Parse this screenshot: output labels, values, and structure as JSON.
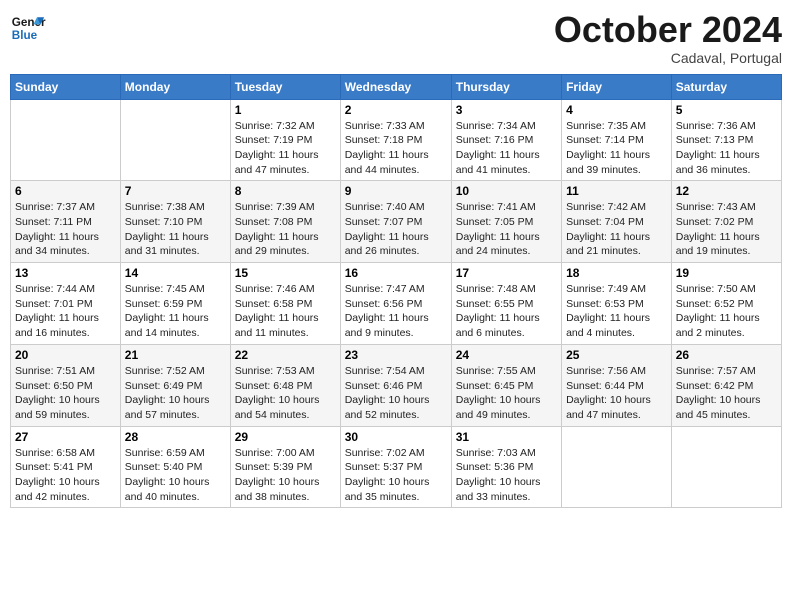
{
  "logo": {
    "line1": "General",
    "line2": "Blue"
  },
  "title": "October 2024",
  "location": "Cadaval, Portugal",
  "days_header": [
    "Sunday",
    "Monday",
    "Tuesday",
    "Wednesday",
    "Thursday",
    "Friday",
    "Saturday"
  ],
  "weeks": [
    [
      {
        "day": "",
        "sunrise": "",
        "sunset": "",
        "daylight": ""
      },
      {
        "day": "",
        "sunrise": "",
        "sunset": "",
        "daylight": ""
      },
      {
        "day": "1",
        "sunrise": "Sunrise: 7:32 AM",
        "sunset": "Sunset: 7:19 PM",
        "daylight": "Daylight: 11 hours and 47 minutes."
      },
      {
        "day": "2",
        "sunrise": "Sunrise: 7:33 AM",
        "sunset": "Sunset: 7:18 PM",
        "daylight": "Daylight: 11 hours and 44 minutes."
      },
      {
        "day": "3",
        "sunrise": "Sunrise: 7:34 AM",
        "sunset": "Sunset: 7:16 PM",
        "daylight": "Daylight: 11 hours and 41 minutes."
      },
      {
        "day": "4",
        "sunrise": "Sunrise: 7:35 AM",
        "sunset": "Sunset: 7:14 PM",
        "daylight": "Daylight: 11 hours and 39 minutes."
      },
      {
        "day": "5",
        "sunrise": "Sunrise: 7:36 AM",
        "sunset": "Sunset: 7:13 PM",
        "daylight": "Daylight: 11 hours and 36 minutes."
      }
    ],
    [
      {
        "day": "6",
        "sunrise": "Sunrise: 7:37 AM",
        "sunset": "Sunset: 7:11 PM",
        "daylight": "Daylight: 11 hours and 34 minutes."
      },
      {
        "day": "7",
        "sunrise": "Sunrise: 7:38 AM",
        "sunset": "Sunset: 7:10 PM",
        "daylight": "Daylight: 11 hours and 31 minutes."
      },
      {
        "day": "8",
        "sunrise": "Sunrise: 7:39 AM",
        "sunset": "Sunset: 7:08 PM",
        "daylight": "Daylight: 11 hours and 29 minutes."
      },
      {
        "day": "9",
        "sunrise": "Sunrise: 7:40 AM",
        "sunset": "Sunset: 7:07 PM",
        "daylight": "Daylight: 11 hours and 26 minutes."
      },
      {
        "day": "10",
        "sunrise": "Sunrise: 7:41 AM",
        "sunset": "Sunset: 7:05 PM",
        "daylight": "Daylight: 11 hours and 24 minutes."
      },
      {
        "day": "11",
        "sunrise": "Sunrise: 7:42 AM",
        "sunset": "Sunset: 7:04 PM",
        "daylight": "Daylight: 11 hours and 21 minutes."
      },
      {
        "day": "12",
        "sunrise": "Sunrise: 7:43 AM",
        "sunset": "Sunset: 7:02 PM",
        "daylight": "Daylight: 11 hours and 19 minutes."
      }
    ],
    [
      {
        "day": "13",
        "sunrise": "Sunrise: 7:44 AM",
        "sunset": "Sunset: 7:01 PM",
        "daylight": "Daylight: 11 hours and 16 minutes."
      },
      {
        "day": "14",
        "sunrise": "Sunrise: 7:45 AM",
        "sunset": "Sunset: 6:59 PM",
        "daylight": "Daylight: 11 hours and 14 minutes."
      },
      {
        "day": "15",
        "sunrise": "Sunrise: 7:46 AM",
        "sunset": "Sunset: 6:58 PM",
        "daylight": "Daylight: 11 hours and 11 minutes."
      },
      {
        "day": "16",
        "sunrise": "Sunrise: 7:47 AM",
        "sunset": "Sunset: 6:56 PM",
        "daylight": "Daylight: 11 hours and 9 minutes."
      },
      {
        "day": "17",
        "sunrise": "Sunrise: 7:48 AM",
        "sunset": "Sunset: 6:55 PM",
        "daylight": "Daylight: 11 hours and 6 minutes."
      },
      {
        "day": "18",
        "sunrise": "Sunrise: 7:49 AM",
        "sunset": "Sunset: 6:53 PM",
        "daylight": "Daylight: 11 hours and 4 minutes."
      },
      {
        "day": "19",
        "sunrise": "Sunrise: 7:50 AM",
        "sunset": "Sunset: 6:52 PM",
        "daylight": "Daylight: 11 hours and 2 minutes."
      }
    ],
    [
      {
        "day": "20",
        "sunrise": "Sunrise: 7:51 AM",
        "sunset": "Sunset: 6:50 PM",
        "daylight": "Daylight: 10 hours and 59 minutes."
      },
      {
        "day": "21",
        "sunrise": "Sunrise: 7:52 AM",
        "sunset": "Sunset: 6:49 PM",
        "daylight": "Daylight: 10 hours and 57 minutes."
      },
      {
        "day": "22",
        "sunrise": "Sunrise: 7:53 AM",
        "sunset": "Sunset: 6:48 PM",
        "daylight": "Daylight: 10 hours and 54 minutes."
      },
      {
        "day": "23",
        "sunrise": "Sunrise: 7:54 AM",
        "sunset": "Sunset: 6:46 PM",
        "daylight": "Daylight: 10 hours and 52 minutes."
      },
      {
        "day": "24",
        "sunrise": "Sunrise: 7:55 AM",
        "sunset": "Sunset: 6:45 PM",
        "daylight": "Daylight: 10 hours and 49 minutes."
      },
      {
        "day": "25",
        "sunrise": "Sunrise: 7:56 AM",
        "sunset": "Sunset: 6:44 PM",
        "daylight": "Daylight: 10 hours and 47 minutes."
      },
      {
        "day": "26",
        "sunrise": "Sunrise: 7:57 AM",
        "sunset": "Sunset: 6:42 PM",
        "daylight": "Daylight: 10 hours and 45 minutes."
      }
    ],
    [
      {
        "day": "27",
        "sunrise": "Sunrise: 6:58 AM",
        "sunset": "Sunset: 5:41 PM",
        "daylight": "Daylight: 10 hours and 42 minutes."
      },
      {
        "day": "28",
        "sunrise": "Sunrise: 6:59 AM",
        "sunset": "Sunset: 5:40 PM",
        "daylight": "Daylight: 10 hours and 40 minutes."
      },
      {
        "day": "29",
        "sunrise": "Sunrise: 7:00 AM",
        "sunset": "Sunset: 5:39 PM",
        "daylight": "Daylight: 10 hours and 38 minutes."
      },
      {
        "day": "30",
        "sunrise": "Sunrise: 7:02 AM",
        "sunset": "Sunset: 5:37 PM",
        "daylight": "Daylight: 10 hours and 35 minutes."
      },
      {
        "day": "31",
        "sunrise": "Sunrise: 7:03 AM",
        "sunset": "Sunset: 5:36 PM",
        "daylight": "Daylight: 10 hours and 33 minutes."
      },
      {
        "day": "",
        "sunrise": "",
        "sunset": "",
        "daylight": ""
      },
      {
        "day": "",
        "sunrise": "",
        "sunset": "",
        "daylight": ""
      }
    ]
  ]
}
